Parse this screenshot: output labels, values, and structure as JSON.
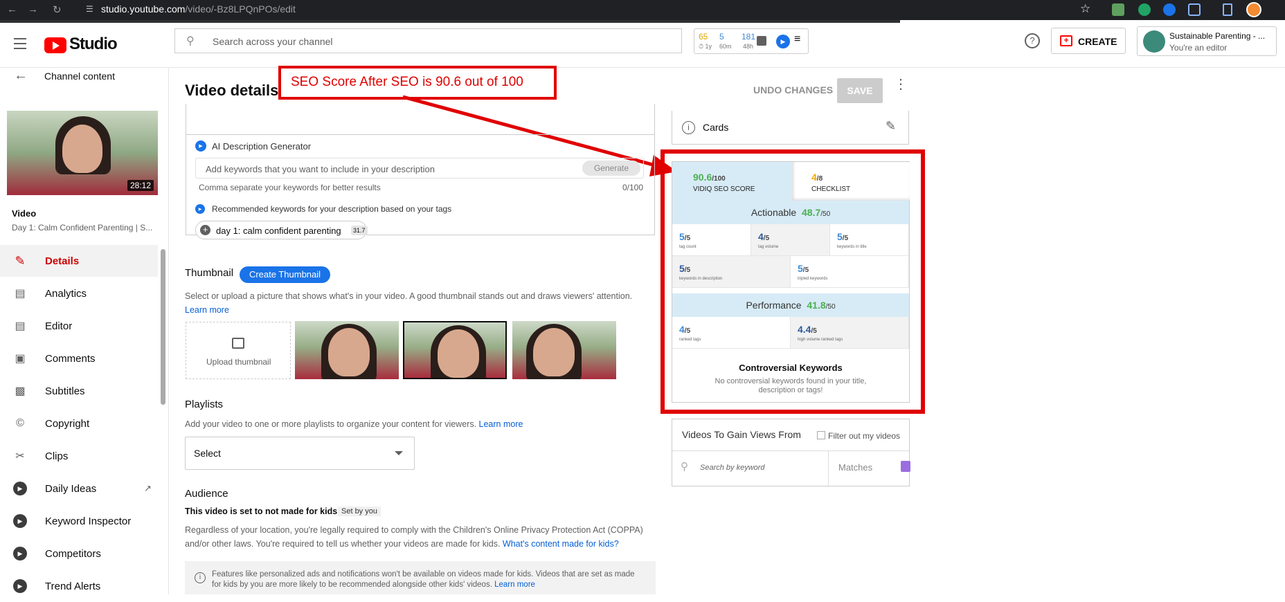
{
  "browser": {
    "url_host": "studio.youtube.com",
    "url_path": "/video/-Bz8LPQnPOs/edit"
  },
  "header": {
    "logo_text": "Studio",
    "search_placeholder": "Search across your channel",
    "stats": [
      {
        "value": "65",
        "label": "1y"
      },
      {
        "value": "5",
        "label": "60m"
      },
      {
        "value": "181",
        "label": "48h"
      }
    ],
    "create_label": "CREATE",
    "channel_name": "Sustainable Parenting - ...",
    "channel_role": "You're an editor"
  },
  "sidebar": {
    "back_label": "Channel content",
    "duration": "28:12",
    "video_label": "Video",
    "video_title": "Day 1: Calm Confident Parenting | S...",
    "items": [
      {
        "label": "Details",
        "icon": "pencil-icon"
      },
      {
        "label": "Analytics",
        "icon": "analytics-icon"
      },
      {
        "label": "Editor",
        "icon": "editor-icon"
      },
      {
        "label": "Comments",
        "icon": "comments-icon"
      },
      {
        "label": "Subtitles",
        "icon": "subtitles-icon"
      },
      {
        "label": "Copyright",
        "icon": "copyright-icon"
      },
      {
        "label": "Clips",
        "icon": "scissors-icon"
      },
      {
        "label": "Daily Ideas",
        "icon": "vidiq-icon"
      },
      {
        "label": "Keyword Inspector",
        "icon": "vidiq-icon"
      },
      {
        "label": "Competitors",
        "icon": "vidiq-icon"
      },
      {
        "label": "Trend Alerts",
        "icon": "vidiq-icon"
      }
    ]
  },
  "page": {
    "title": "Video details",
    "undo_label": "UNDO CHANGES",
    "save_label": "SAVE"
  },
  "annotation": {
    "text": "SEO Score After SEO is 90.6 out of 100"
  },
  "ai_desc": {
    "title": "AI Description Generator",
    "placeholder": "Add keywords that you want to include in your description",
    "generate_label": "Generate",
    "hint": "Comma separate your keywords for better results",
    "counter": "0/100",
    "recommended_title": "Recommended keywords for your description based on your tags",
    "chip_label": "day 1: calm confident parenting",
    "chip_score": "31.7"
  },
  "thumbnail": {
    "title": "Thumbnail",
    "create_label": "Create Thumbnail",
    "desc": "Select or upload a picture that shows what's in your video. A good thumbnail stands out and draws viewers' attention.",
    "learn_more": "Learn more",
    "upload_label": "Upload thumbnail"
  },
  "playlists": {
    "title": "Playlists",
    "desc": "Add your video to one or more playlists to organize your content for viewers.",
    "learn_more": "Learn more",
    "select_label": "Select"
  },
  "audience": {
    "title": "Audience",
    "status": "This video is set to not made for kids",
    "set_by": "Set by you",
    "desc": "Regardless of your location, you're legally required to comply with the Children's Online Privacy Protection Act (COPPA) and/or other laws. You're required to tell us whether your videos are made for kids.",
    "link": "What's content made for kids?",
    "info": "Features like personalized ads and notifications won't be available on videos made for kids. Videos that are set as made for kids by you are more likely to be recommended alongside other kids' videos.",
    "info_link": "Learn more"
  },
  "cards": {
    "label": "Cards"
  },
  "seo": {
    "score": "90.6",
    "score_max": "/100",
    "score_label": "VIDIQ SEO SCORE",
    "checklist": "4",
    "checklist_max": "/8",
    "checklist_label": "CHECKLIST",
    "actionable_label": "Actionable",
    "actionable_score": "48.7",
    "actionable_max": "/50",
    "actionable": [
      {
        "value": "5",
        "max": "/5",
        "label": "tag count"
      },
      {
        "value": "4",
        "max": "/5",
        "label": "tag volume"
      },
      {
        "value": "5",
        "max": "/5",
        "label": "keywords in title"
      },
      {
        "value": "5",
        "max": "/5",
        "label": "keywords in description"
      },
      {
        "value": "5",
        "max": "/5",
        "label": "tripled keywords"
      }
    ],
    "performance_label": "Performance",
    "performance_score": "41.8",
    "performance_max": "/50",
    "performance": [
      {
        "value": "4",
        "max": "/5",
        "label": "ranked tags"
      },
      {
        "value": "4.4",
        "max": "/5",
        "label": "high volume ranked tags"
      }
    ],
    "controversial_title": "Controversial Keywords",
    "controversial_text": "No controversial keywords found in your title, description or tags!"
  },
  "gain": {
    "title": "Videos To Gain Views From",
    "filter_label": "Filter out my videos",
    "search_placeholder": "Search by keyword",
    "matches_label": "Matches"
  },
  "colors": {
    "yt_red": "#ff0000",
    "annotation_red": "#e00000",
    "vidiq_green": "#4caf50",
    "vidiq_blue": "#3c8ad6",
    "link_blue": "#065fd4"
  }
}
